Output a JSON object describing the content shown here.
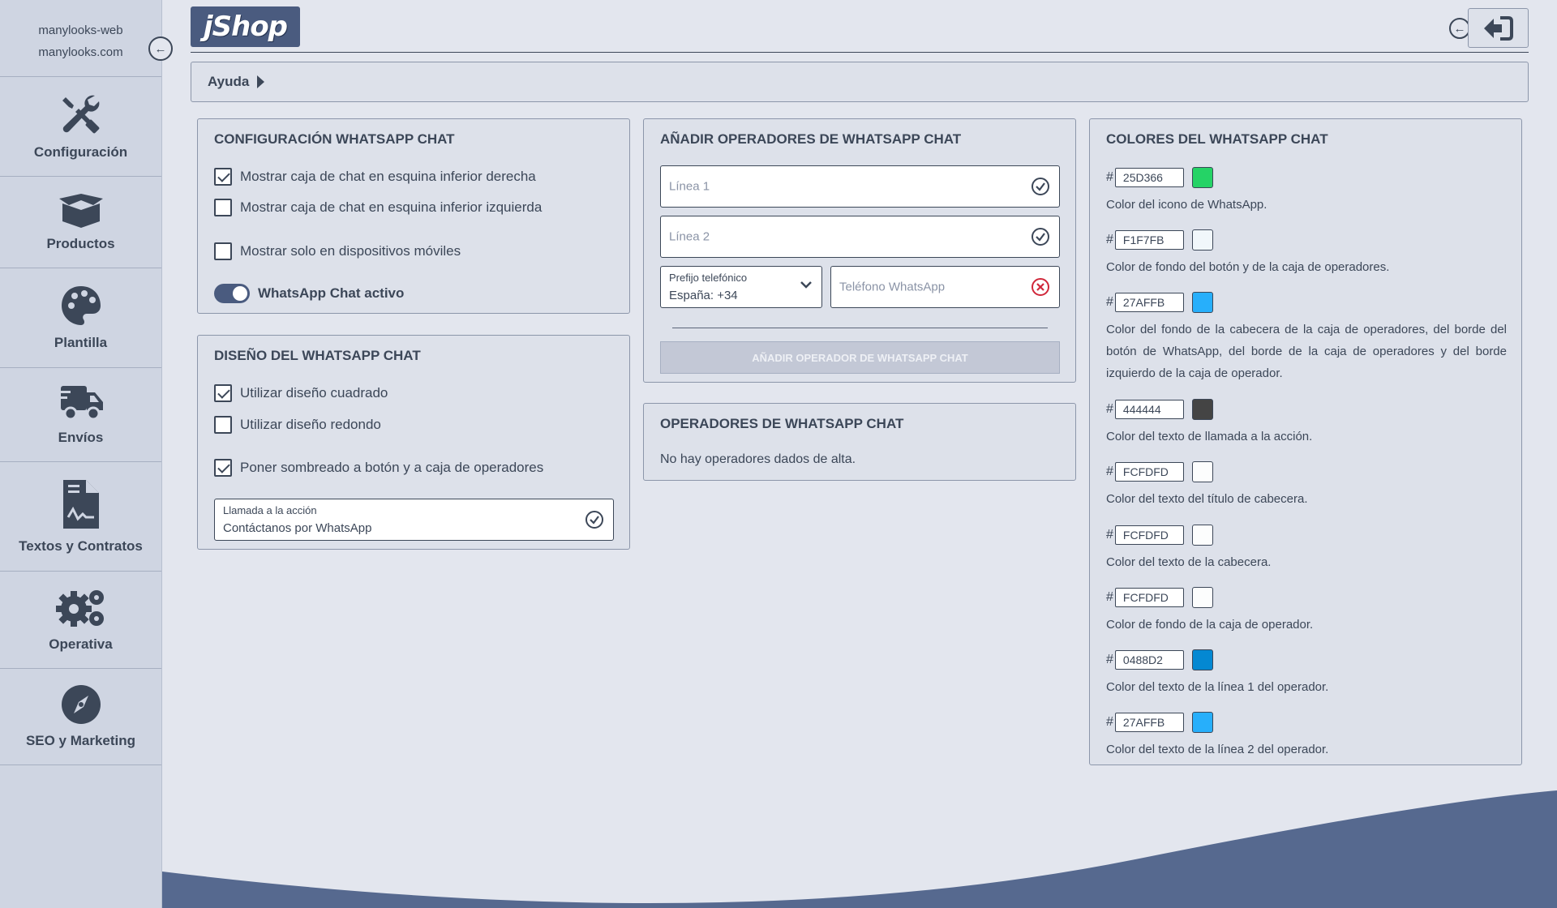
{
  "sidebar": {
    "site_name": "manylooks-web",
    "site_domain": "manylooks.com",
    "collapse_icon": "arrow-left-circle-icon",
    "items": [
      {
        "label": "Configuración",
        "icon": "tools-icon"
      },
      {
        "label": "Productos",
        "icon": "box-icon"
      },
      {
        "label": "Plantilla",
        "icon": "palette-icon"
      },
      {
        "label": "Envíos",
        "icon": "truck-icon"
      },
      {
        "label": "Textos y Contratos",
        "icon": "document-signature-icon"
      },
      {
        "label": "Operativa",
        "icon": "gears-icon"
      },
      {
        "label": "SEO y Marketing",
        "icon": "compass-icon"
      }
    ]
  },
  "header": {
    "logo": "jShop",
    "back_icon": "arrow-left-circle-icon",
    "exit_icon": "sign-out-icon"
  },
  "help": {
    "label": "Ayuda"
  },
  "config_panel": {
    "title": "CONFIGURACIÓN WHATSAPP CHAT",
    "options": [
      {
        "label": "Mostrar caja de chat en esquina inferior derecha",
        "checked": true
      },
      {
        "label": "Mostrar caja de chat en esquina inferior izquierda",
        "checked": false
      },
      {
        "label": "Mostrar solo en dispositivos móviles",
        "checked": false
      }
    ],
    "toggle_label": "WhatsApp Chat activo",
    "toggle_on": true
  },
  "design_panel": {
    "title": "DISEÑO DEL WHATSAPP CHAT",
    "options": [
      {
        "label": "Utilizar diseño cuadrado",
        "checked": true
      },
      {
        "label": "Utilizar diseño redondo",
        "checked": false
      },
      {
        "label": "Poner sombreado a botón y a caja de operadores",
        "checked": true
      }
    ],
    "cta_label": "Llamada a la acción",
    "cta_value": "Contáctanos por WhatsApp"
  },
  "add_panel": {
    "title": "AÑADIR OPERADORES DE WHATSAPP CHAT",
    "line1_placeholder": "Línea 1",
    "line2_placeholder": "Línea 2",
    "prefix_label": "Prefijo telefónico",
    "prefix_value": "España: +34",
    "phone_placeholder": "Teléfono WhatsApp",
    "button_label": "AÑADIR OPERADOR DE WHATSAPP CHAT"
  },
  "operators_panel": {
    "title": "OPERADORES DE WHATSAPP CHAT",
    "empty_text": "No hay operadores dados de alta."
  },
  "colors_panel": {
    "title": "COLORES DEL WHATSAPP CHAT",
    "hash": "#",
    "colors": [
      {
        "hex": "25D366",
        "swatch": "#25D366",
        "desc": "Color del icono de WhatsApp."
      },
      {
        "hex": "F1F7FB",
        "swatch": "#F1F7FB",
        "desc": "Color de fondo del botón y de la caja de operadores."
      },
      {
        "hex": "27AFFB",
        "swatch": "#27AFFB",
        "desc": "Color del fondo de la cabecera de la caja de operadores, del borde del botón de WhatsApp, del borde de la caja de operadores y del borde izquierdo de la caja de operador."
      },
      {
        "hex": "444444",
        "swatch": "#444444",
        "desc": "Color del texto de llamada a la acción."
      },
      {
        "hex": "FCFDFD",
        "swatch": "#FCFDFD",
        "desc": "Color del texto del título de cabecera."
      },
      {
        "hex": "FCFDFD",
        "swatch": "#FCFDFD",
        "desc": "Color del texto de la cabecera."
      },
      {
        "hex": "FCFDFD",
        "swatch": "#FCFDFD",
        "desc": "Color de fondo de la caja de operador."
      },
      {
        "hex": "0488D2",
        "swatch": "#0488D2",
        "desc": "Color del texto de la línea 1 del operador."
      },
      {
        "hex": "27AFFB",
        "swatch": "#27AFFB",
        "desc": "Color del texto de la línea 2 del operador."
      }
    ]
  },
  "theme": {
    "primary": "#4a5b7f",
    "text": "#3c4758",
    "sidebar_bg": "#cfd5e2",
    "page_bg": "#e3e6ee",
    "error": "#d0273a"
  }
}
